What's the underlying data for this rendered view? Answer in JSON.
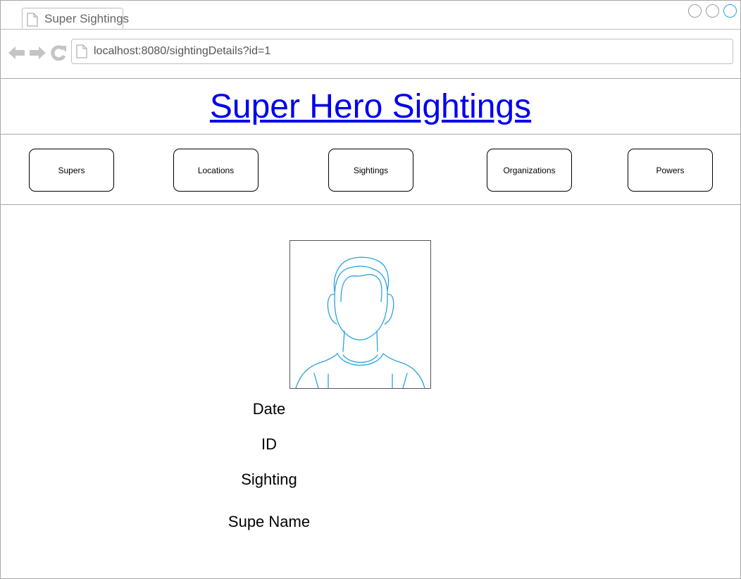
{
  "browser": {
    "tab_title": "Super Sightings",
    "url": "localhost:8080/sightingDetails?id=1"
  },
  "header": {
    "title": "Super Hero Sightings"
  },
  "nav": {
    "items": [
      {
        "label": "Supers"
      },
      {
        "label": "Locations"
      },
      {
        "label": "Sightings"
      },
      {
        "label": "Organizations"
      },
      {
        "label": "Powers"
      }
    ]
  },
  "details": {
    "date_label": "Date",
    "id_label": "ID",
    "sighting_label": "Sighting",
    "supe_name_label": "Supe Name"
  },
  "colors": {
    "link": "#0000ee",
    "avatar_stroke": "#29a3e0",
    "window_active_control": "#29a3e0"
  },
  "icons": {
    "back": "arrow-left-icon",
    "forward": "arrow-right-icon",
    "reload": "reload-icon",
    "page": "document-icon",
    "avatar": "person-silhouette-icon"
  }
}
